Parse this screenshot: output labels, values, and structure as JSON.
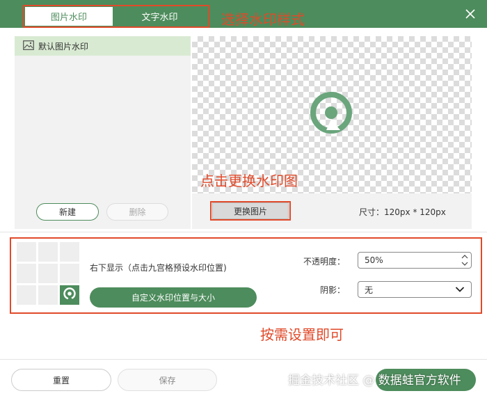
{
  "header": {
    "tabs": [
      {
        "label": "图片水印",
        "active": true
      },
      {
        "label": "文字水印",
        "active": false
      }
    ],
    "close_icon": "close-icon"
  },
  "watermark_list": {
    "items": [
      {
        "icon": "image-icon",
        "label": "默认图片水印",
        "selected": true
      }
    ]
  },
  "list_actions": {
    "new_label": "新建",
    "delete_label": "删除"
  },
  "preview": {
    "replace_label": "更换图片",
    "size_text": "尺寸：120px * 120px"
  },
  "position": {
    "grid_rows": 3,
    "grid_cols": 3,
    "selected_cell": "bottom-right",
    "description": "右下显示（点击九宫格预设水印位置)",
    "custom_button_label": "自定义水印位置与大小"
  },
  "opacity": {
    "label": "不透明度：",
    "value": "50%"
  },
  "shadow": {
    "label": "阴影：",
    "value": "无"
  },
  "footer": {
    "reset_label": "重置",
    "save_label": "保存"
  },
  "annotations": {
    "choose_style": "选择水印样式",
    "replace_hint": "点击更换水印图",
    "settings_hint": "按需设置即可"
  },
  "overlay_watermark": "掘金技术社区 @ 数据蛙官方软件",
  "colors": {
    "accent": "#4d8c5c",
    "annotation": "#e04a2a",
    "selected_bg": "#d9ead3"
  }
}
